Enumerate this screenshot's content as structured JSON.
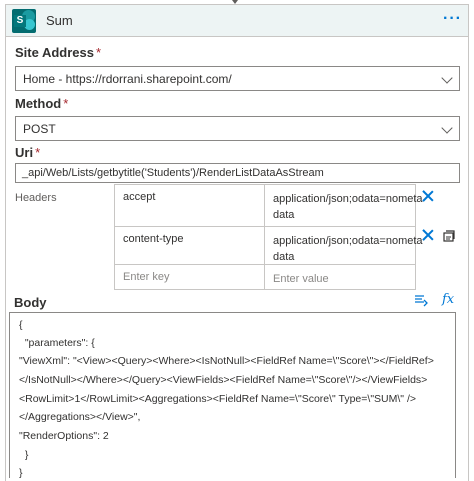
{
  "header": {
    "title": "Sum",
    "more_icon": "more-ellipsis-icon",
    "app_icon": "sharepoint-icon"
  },
  "site_address": {
    "label": "Site Address",
    "required_mark": "*",
    "value": "Home - https://rdorrani.sharepoint.com/"
  },
  "method": {
    "label": "Method",
    "required_mark": "*",
    "value": "POST"
  },
  "uri": {
    "label": "Uri",
    "required_mark": "*",
    "value": "_api/Web/Lists/getbytitle('Students')/RenderListDataAsStream"
  },
  "headers": {
    "label": "Headers",
    "rows": [
      {
        "key": "accept",
        "value_line1": "application/json;odata=nometa",
        "value_line2": "data"
      },
      {
        "key": "content-type",
        "value_line1": "application/json;odata=nometa",
        "value_line2": "data"
      }
    ],
    "key_placeholder": "Enter key",
    "value_placeholder": "Enter value"
  },
  "body": {
    "label": "Body",
    "lines": [
      "{",
      "  \"parameters\": {",
      "\"ViewXml\": \"<View><Query><Where><IsNotNull><FieldRef Name=\\\"Score\\\"></FieldRef>",
      "</IsNotNull></Where></Query><ViewFields><FieldRef Name=\\\"Score\\\"/></ViewFields>",
      "<RowLimit>1</RowLimit><Aggregations><FieldRef Name=\\\"Score\\\" Type=\\\"SUM\\\" />",
      "</Aggregations></View>\",",
      "\"RenderOptions\": 2",
      "  }",
      "}"
    ]
  },
  "colors": {
    "accent": "#0078d4",
    "header_bg": "#edf4f4",
    "required": "#a4262c",
    "sharepoint": "#036c70"
  }
}
